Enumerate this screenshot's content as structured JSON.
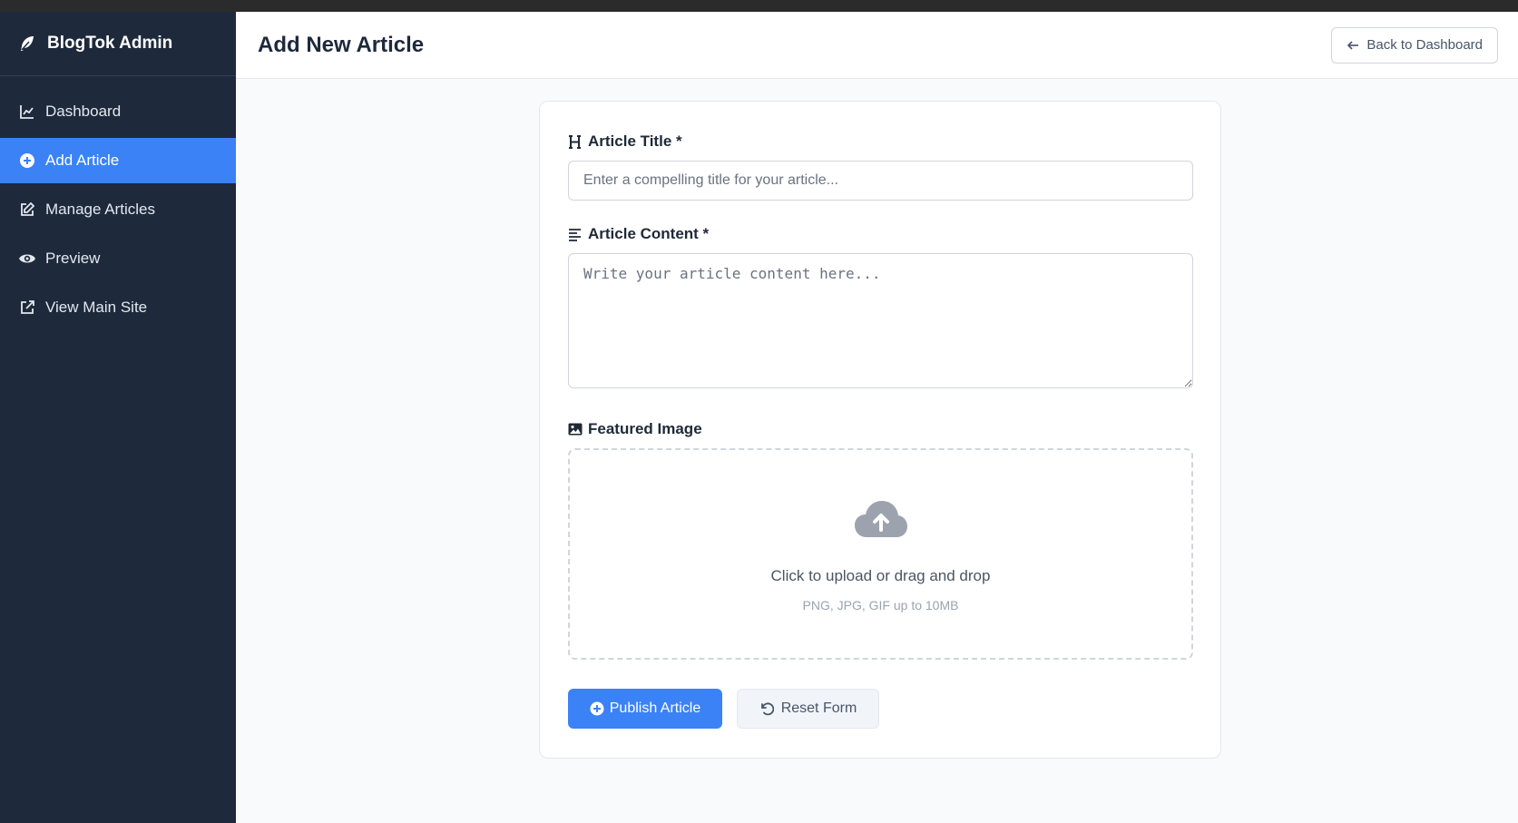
{
  "app": {
    "brand_name": "BlogTok Admin",
    "brand_icon": "feather-icon"
  },
  "sidebar": {
    "items": [
      {
        "label": "Dashboard",
        "icon": "chart-line-icon",
        "active": false
      },
      {
        "label": "Add Article",
        "icon": "plus-circle-icon",
        "active": true
      },
      {
        "label": "Manage Articles",
        "icon": "edit-icon",
        "active": false
      },
      {
        "label": "Preview",
        "icon": "eye-icon",
        "active": false
      },
      {
        "label": "View Main Site",
        "icon": "external-link-icon",
        "active": false
      }
    ]
  },
  "header": {
    "title": "Add New Article",
    "back_button": "Back to Dashboard"
  },
  "form": {
    "title_label": "Article Title *",
    "title_value": "",
    "title_placeholder": "Enter a compelling title for your article...",
    "content_label": "Article Content *",
    "content_value": "",
    "content_placeholder": "Write your article content here...",
    "image_label": "Featured Image",
    "upload_main": "Click to upload or drag and drop",
    "upload_sub": "PNG, JPG, GIF up to 10MB",
    "publish_button": "Publish Article",
    "reset_button": "Reset Form"
  },
  "colors": {
    "sidebar_bg": "#1e293b",
    "accent": "#3b82f6",
    "page_bg": "#f8fafc"
  }
}
